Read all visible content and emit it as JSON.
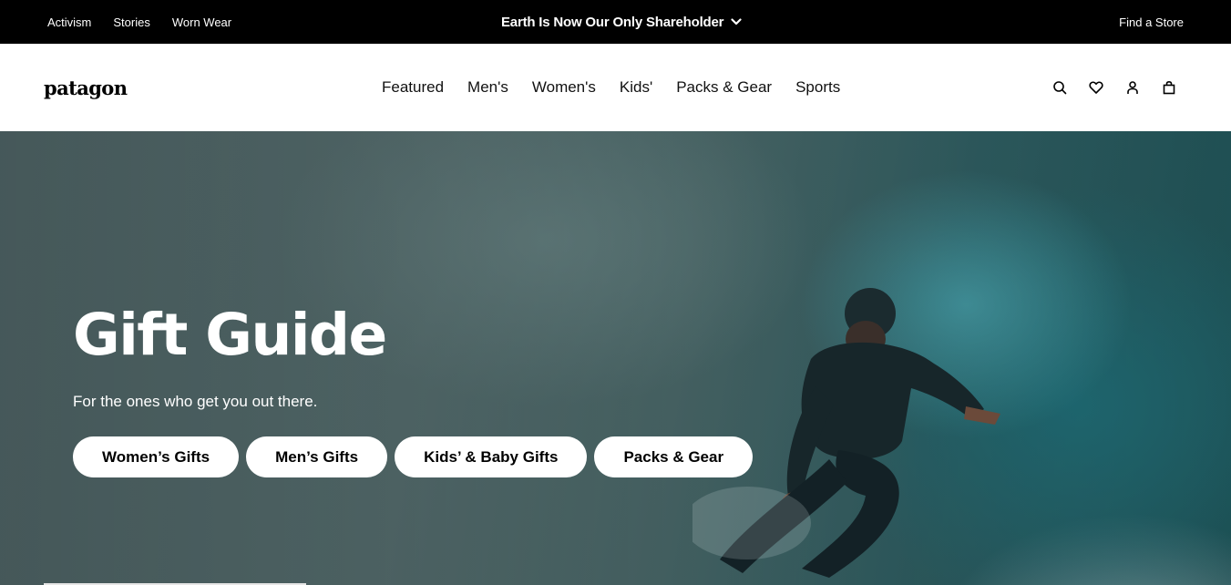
{
  "topbar": {
    "links": [
      "Activism",
      "Stories",
      "Worn Wear"
    ],
    "announcement": "Earth Is Now Our Only Shareholder",
    "find_store": "Find a Store"
  },
  "header": {
    "logo": "patagon",
    "nav": [
      "Featured",
      "Men's",
      "Women's",
      "Kids'",
      "Packs & Gear",
      "Sports"
    ],
    "icons": [
      "search-icon",
      "heart-icon",
      "account-icon",
      "bag-icon"
    ]
  },
  "hero": {
    "title": "Gift Guide",
    "subtitle": "For the ones who get you out there.",
    "buttons": [
      "Women’s Gifts",
      "Men’s Gifts",
      "Kids’ & Baby Gifts",
      "Packs & Gear"
    ]
  },
  "colors": {
    "topbar_bg": "#000000",
    "hero_accent": "#2f5e62",
    "button_bg": "#ffffff"
  }
}
